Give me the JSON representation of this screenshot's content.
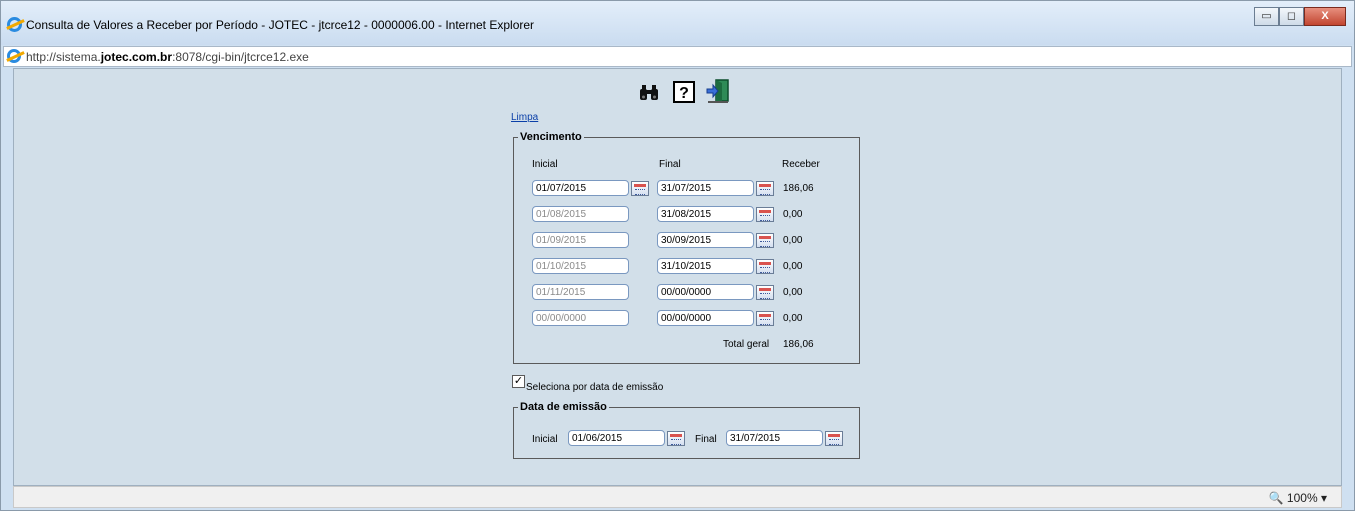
{
  "window": {
    "title": "Consulta de Valores a Receber por Período - JOTEC - jtcrce12 - 0000006.00 - Internet Explorer",
    "minimize_label": "▭",
    "maximize_label": "◻",
    "close_label": "X"
  },
  "address": {
    "prefix": "http://sistema.",
    "domain": "jotec.com.br",
    "suffix": ":8078/cgi-bin/jtcrce12.exe"
  },
  "toolbar": {
    "icons": [
      "binoculars-icon",
      "help-icon",
      "exit-icon"
    ]
  },
  "limpa_label": "Limpa",
  "vencimento": {
    "legend": "Vencimento",
    "headers": {
      "inicial": "Inicial",
      "final": "Final",
      "receber": "Receber"
    },
    "rows": [
      {
        "inicial": "01/07/2015",
        "final": "31/07/2015",
        "receber": "186,06",
        "inicial_enabled": true
      },
      {
        "inicial": "01/08/2015",
        "final": "31/08/2015",
        "receber": "0,00",
        "inicial_enabled": false
      },
      {
        "inicial": "01/09/2015",
        "final": "30/09/2015",
        "receber": "0,00",
        "inicial_enabled": false
      },
      {
        "inicial": "01/10/2015",
        "final": "31/10/2015",
        "receber": "0,00",
        "inicial_enabled": false
      },
      {
        "inicial": "01/11/2015",
        "final": "00/00/0000",
        "receber": "0,00",
        "inicial_enabled": false
      },
      {
        "inicial": "00/00/0000",
        "final": "00/00/0000",
        "receber": "0,00",
        "inicial_enabled": false
      }
    ],
    "total_label": "Total geral",
    "total_value": "186,06"
  },
  "seleciona": {
    "label": "Seleciona por data de emissão",
    "checked": true,
    "check_mark": "✓"
  },
  "emissao": {
    "legend": "Data de emissão",
    "inicial_label": "Inicial",
    "inicial_value": "01/06/2015",
    "final_label": "Final",
    "final_value": "31/07/2015"
  },
  "status": {
    "zoom": "100%",
    "zoom_icon": "🔍",
    "dropdown": "▾"
  }
}
